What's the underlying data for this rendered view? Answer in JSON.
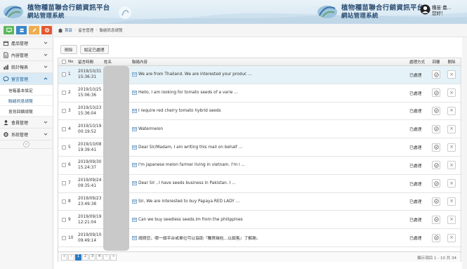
{
  "header": {
    "title_line1": "植物種苗聯合行銷資訊平台",
    "title_line2": "網站管理系統",
    "user_name_line1": "種苗·農...",
    "user_name_line2": "您好！"
  },
  "sidebar": {
    "quick_buttons": [
      "monitor",
      "users",
      "edit",
      "settings"
    ],
    "items": [
      {
        "label": "產品管理",
        "icon": "box-icon"
      },
      {
        "label": "內容管理",
        "icon": "document-icon"
      },
      {
        "label": "統計報表",
        "icon": "bar-chart-icon"
      },
      {
        "label": "留言管理",
        "icon": "chat-icon"
      },
      {
        "label": "會員管理",
        "icon": "user-icon"
      },
      {
        "label": "系統管理",
        "icon": "gear-icon"
      }
    ],
    "sub_items": [
      "信箱基本設定",
      "聯絡訊息總覽",
      "意見回饋總覽"
    ]
  },
  "breadcrumb": {
    "home": "首頁",
    "level1": "留言管理",
    "level2": "聯絡訊息總覽"
  },
  "toolbar": {
    "delete_label": "刪除",
    "mark_processed_label": "設定已處理"
  },
  "table": {
    "headers": {
      "no": "No",
      "date": "留言時間",
      "name": "姓名",
      "content": "聯絡內容",
      "status": "處理方式",
      "view": "回覆",
      "delete": "刪除"
    },
    "rows": [
      {
        "no": "1",
        "date": "2019/10/31",
        "time": "15:36:31",
        "content": "We are from Thailand. We are interested your produc ...",
        "status": "已處理"
      },
      {
        "no": "2",
        "date": "2019/10/25",
        "time": "15:06:36",
        "content": "Hello, I am looking for tomato seeds of a varie ...",
        "status": "已處理"
      },
      {
        "no": "3",
        "date": "2019/10/23",
        "time": "15:36:04",
        "content": "I require red cherry tomato hybrid seeds",
        "status": "已處理"
      },
      {
        "no": "4",
        "date": "2019/10/19",
        "time": "00:19:52",
        "content": "Watermelon",
        "status": "已處理"
      },
      {
        "no": "5",
        "date": "2019/10/08",
        "time": "19:39:41",
        "content": "Dear Sir/Madam,  I am writing this mail on behalf ...",
        "status": "已處理"
      },
      {
        "no": "6",
        "date": "2019/09/30",
        "time": "15:24:37",
        "content": "I'm japanese melon farmer living in vietnam. I'm i ...",
        "status": "已處理"
      },
      {
        "no": "7",
        "date": "2019/09/24",
        "time": "09:35:41",
        "content": "Dear Sir , I have seeds business in Pakistan. I ...",
        "status": "已處理"
      },
      {
        "no": "8",
        "date": "2019/09/23",
        "time": "23:49:38",
        "content": "Sir, We are interested to buy Papaya RED LADY ...",
        "status": "已處理"
      },
      {
        "no": "9",
        "date": "2019/09/19",
        "time": "12:21:04",
        "content": "Can we buy seedless seeds.im from the philippines",
        "status": "已處理"
      },
      {
        "no": "10",
        "date": "2019/09/10",
        "time": "09:49:14",
        "content": "請問您，哪一個平台或單位可以協助『購買幾粒...以銷售』了解謝。",
        "status": "已處理"
      }
    ]
  },
  "pager": {
    "pages": [
      "1",
      "2",
      "3",
      "4"
    ],
    "current": "1",
    "info": "顯示項目 1 - 10 共 34"
  },
  "colors": {
    "accent": "#2a7bc4",
    "highlight_row": "#e5f2f7",
    "quick_green": "#5cb85c",
    "quick_blue": "#3a87c8",
    "quick_orange": "#f0ad4e",
    "quick_red": "#e4572e"
  }
}
